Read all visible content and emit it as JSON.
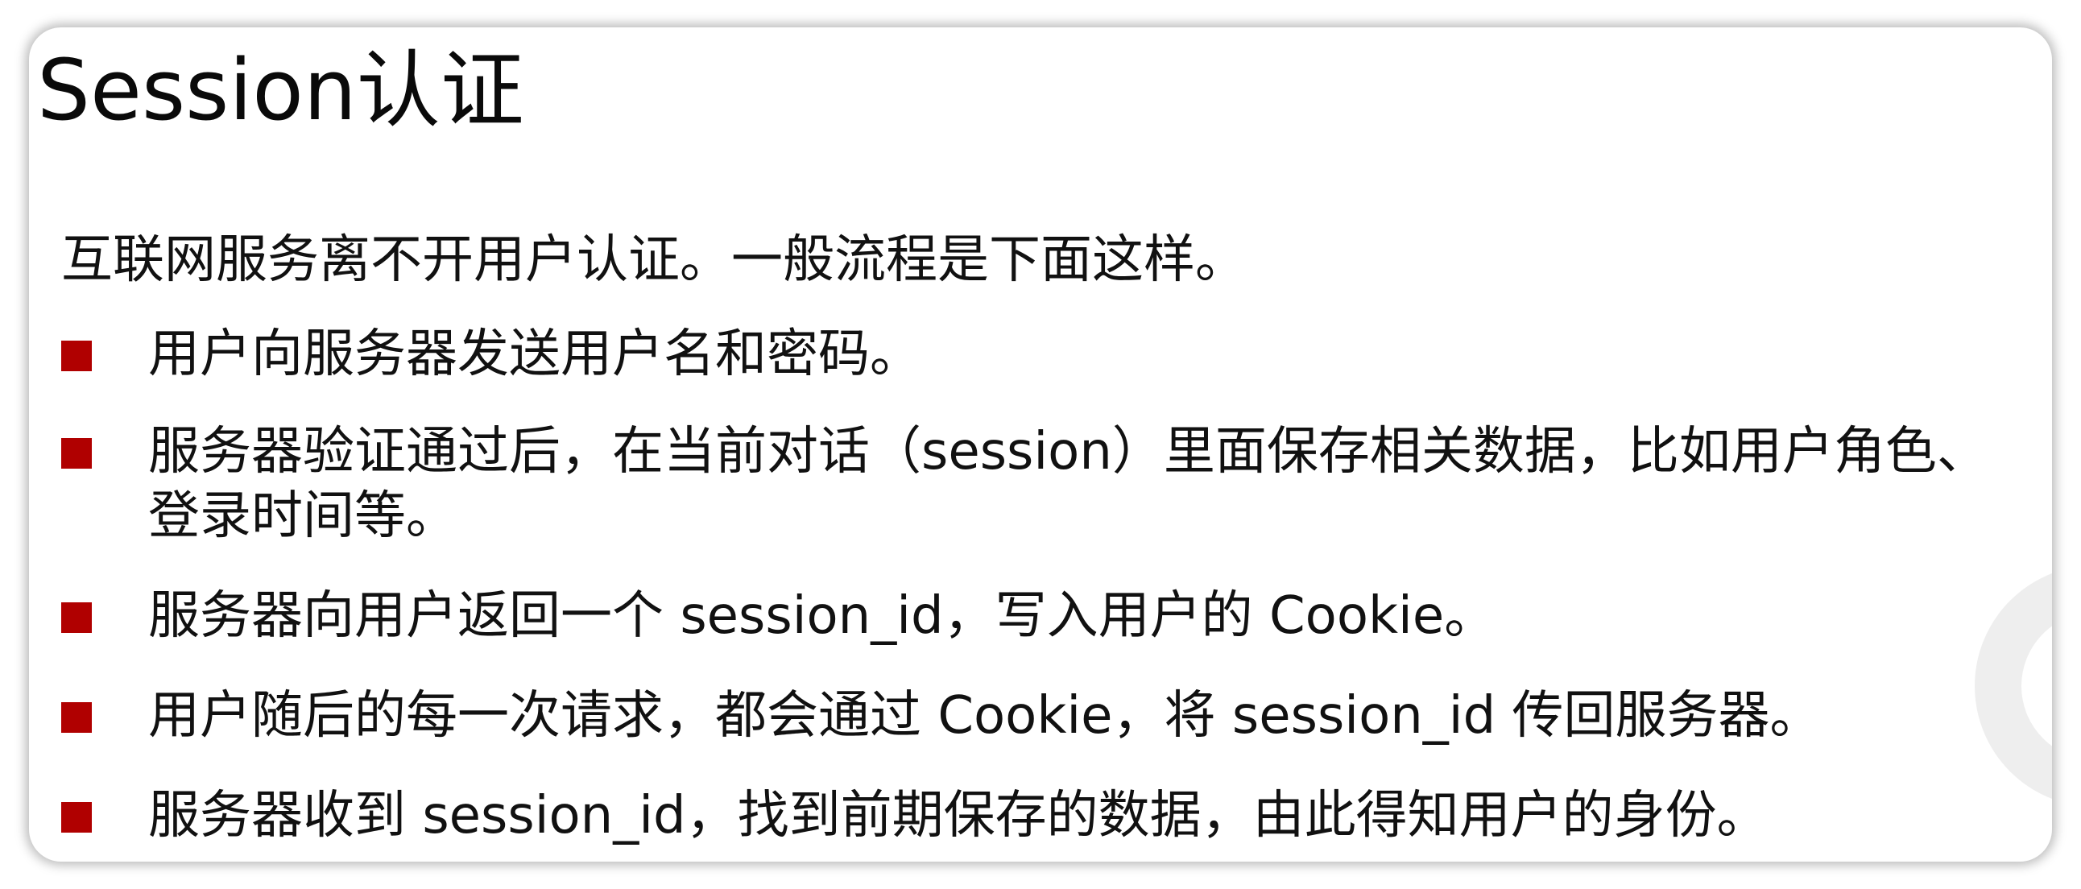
{
  "slide": {
    "title": "Session认证",
    "intro": "互联网服务离不开用户认证。一般流程是下面这样。",
    "bullets": [
      "用户向服务器发送用户名和密码。",
      "服务器验证通过后，在当前对话（session）里面保存相关数据，比如用户角色、登录时间等。",
      "服务器向用户返回一个 session_id，写入用户的 Cookie。",
      "用户随后的每一次请求，都会通过 Cookie，将 session_id 传回服务器。",
      "服务器收到 session_id，找到前期保存的数据，由此得知用户的身份。"
    ]
  },
  "colors": {
    "bullet_marker": "#b00000",
    "text": "#111111",
    "background": "#ffffff"
  }
}
